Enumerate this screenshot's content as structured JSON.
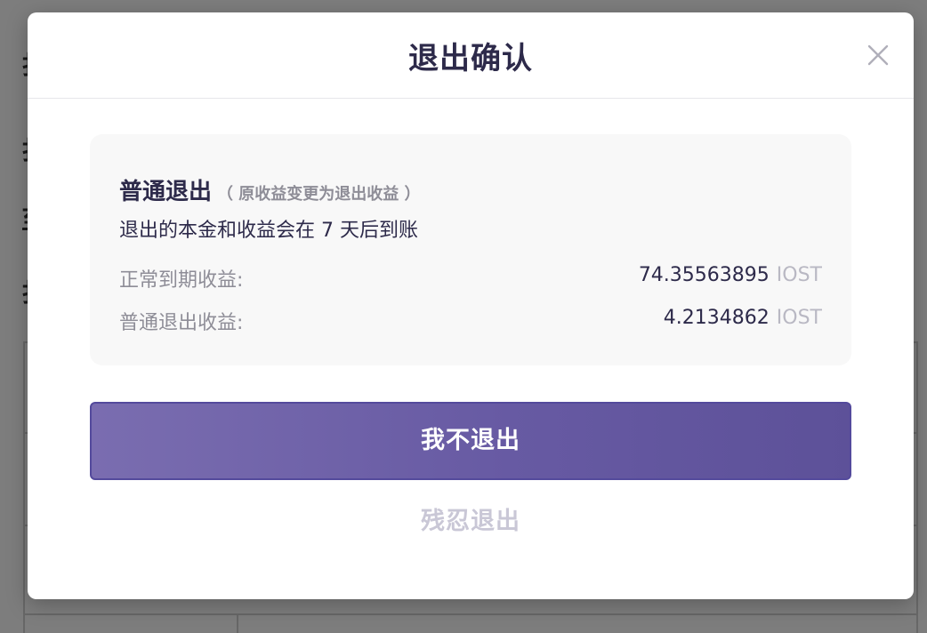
{
  "dialog": {
    "title": "退出确认",
    "close_icon": "close-icon"
  },
  "exit_option": {
    "title": "普通退出",
    "subtitle": "（ 原收益变更为退出收益 ）",
    "description": "退出的本金和收益会在 7 天后到账",
    "rows": [
      {
        "label": "正常到期收益:",
        "value": "74.35563895",
        "unit": "IOST"
      },
      {
        "label": "普通退出收益:",
        "value": "4.2134862",
        "unit": "IOST"
      }
    ]
  },
  "actions": {
    "stay_label": "我不退出",
    "confirm_exit_label": "残忍退出"
  },
  "colors": {
    "title_text": "#2d2a4a",
    "muted_text": "#8e8d97",
    "unit_text": "#b9b8c3",
    "primary_button": "#675aa3",
    "secondary_button_text": "#c9c7d6"
  }
}
